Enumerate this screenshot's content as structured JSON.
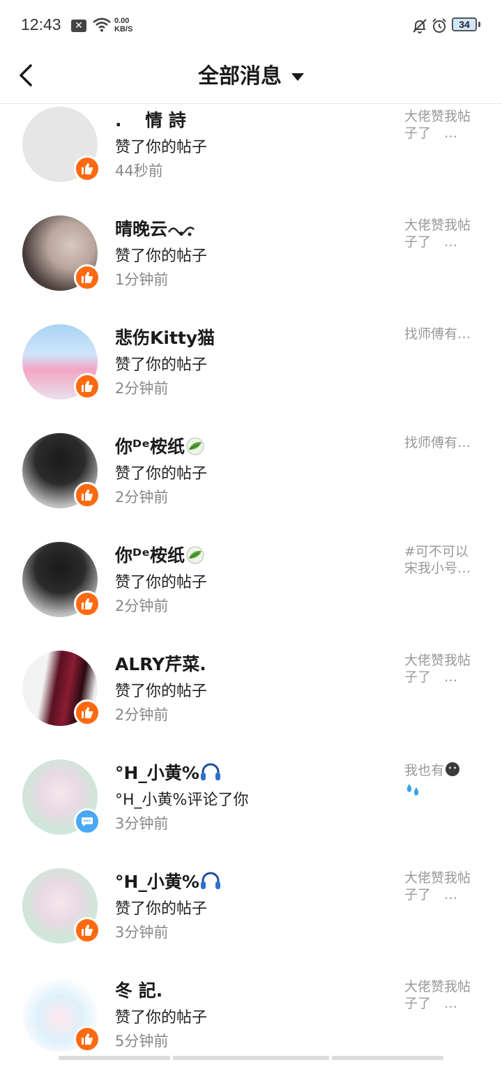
{
  "status_bar": {
    "time": "12:43",
    "speed_value": "0.00",
    "speed_unit": "KB/S",
    "battery": "34"
  },
  "header": {
    "title": "全部消息"
  },
  "icons": {
    "back": "back-arrow-icon",
    "dropdown": "caret-down-icon",
    "like": "thumbs-up-icon",
    "comment": "chat-bubble-icon"
  },
  "colors": {
    "like_badge": "#ff6a10",
    "comment_badge": "#48a8f5",
    "time_text": "#888888",
    "preview_text": "#999999"
  },
  "messages": [
    {
      "name": ".　 情 詩",
      "action": "赞了你的帖子",
      "time": "44秒前",
      "preview": "大佬赞我帖子了　…",
      "type": "like"
    },
    {
      "name": "晴晚云",
      "action": "赞了你的帖子",
      "time": "1分钟前",
      "preview": "大佬赞我帖子了　…",
      "type": "like"
    },
    {
      "name": "悲伤Kitty猫",
      "action": "赞了你的帖子",
      "time": "2分钟前",
      "preview": " 找师傅有…",
      "type": "like"
    },
    {
      "name": "你ᴰᵉ桉纸",
      "action": "赞了你的帖子",
      "time": "2分钟前",
      "preview": " 找师傅有…",
      "type": "like"
    },
    {
      "name": "你ᴰᵉ桉纸",
      "action": "赞了你的帖子",
      "time": "2分钟前",
      "preview": "#可不可以宋我小号…",
      "type": "like"
    },
    {
      "name": "ALRY芹菜.",
      "action": "赞了你的帖子",
      "time": "2分钟前",
      "preview": "大佬赞我帖子了　…",
      "type": "like"
    },
    {
      "name": "°H_小黄%",
      "action": "°H_小黄%评论了你",
      "time": "3分钟前",
      "preview": "我也有",
      "type": "comment"
    },
    {
      "name": "°H_小黄%",
      "action": "赞了你的帖子",
      "time": "3分钟前",
      "preview": "大佬赞我帖子了　…",
      "type": "like"
    },
    {
      "name": "冬 記.",
      "action": "赞了你的帖子",
      "time": "5分钟前",
      "preview": "大佬赞我帖子了　…",
      "type": "like"
    }
  ]
}
